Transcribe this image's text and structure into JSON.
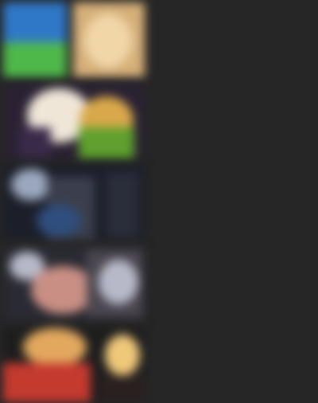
{
  "list": {
    "items": [
      {
        "title": "",
        "meta": "",
        "thumbnail_colors": [
          "#2f78c8",
          "#4fb84a",
          "#d6b07a",
          "#f1d6a8"
        ]
      },
      {
        "title": "",
        "meta": "",
        "thumbnail_colors": [
          "#2a2233",
          "#efe6d8",
          "#d9a84a",
          "#5fa02e"
        ]
      },
      {
        "title": "",
        "meta": "",
        "thumbnail_colors": [
          "#3b3f4d",
          "#9aa7bd",
          "#2f4e7d",
          "#1c1f2a"
        ]
      },
      {
        "title": "",
        "meta": "",
        "thumbnail_colors": [
          "#4b4750",
          "#c98f84",
          "#b7b9c8",
          "#2a2a33"
        ]
      },
      {
        "title": "",
        "meta": "",
        "thumbnail_colors": [
          "#c53a2f",
          "#e2a85e",
          "#f0c87a",
          "#1d1d1d"
        ]
      }
    ]
  },
  "colors": {
    "background": "#262626",
    "title_text": "#8a8a8a",
    "meta_text": "#5a5a5a"
  }
}
